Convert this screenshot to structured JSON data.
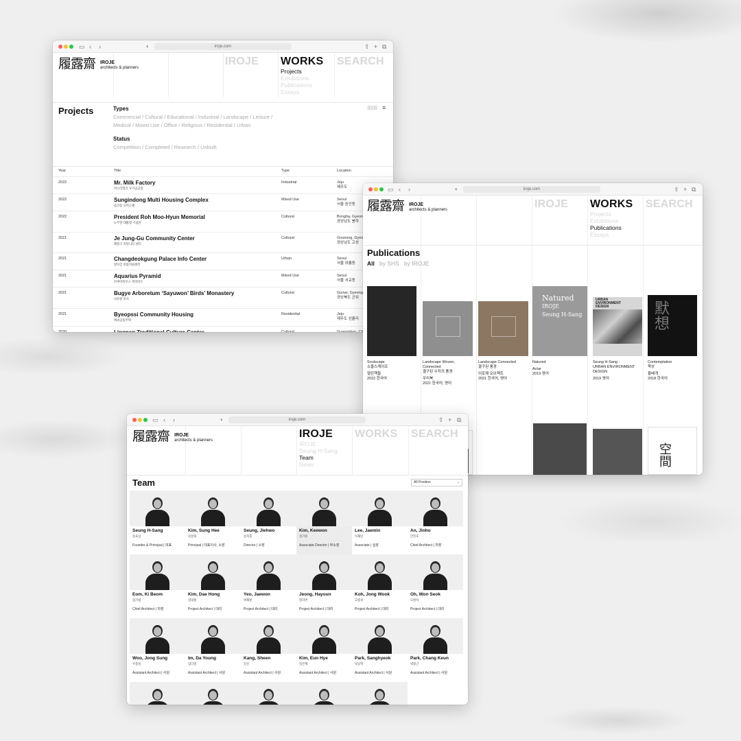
{
  "url": "iroje.com",
  "logo": {
    "hanja": "履露齋",
    "name": "IROJE",
    "tagline": "architects & planners"
  },
  "nav": {
    "iroje": "IROJE",
    "works": "WORKS",
    "search": "SEARCH"
  },
  "works_sub": [
    "Projects",
    "Exhibitions",
    "Publications",
    "Essays"
  ],
  "iroje_sub": [
    "IROJE",
    "Seung H-Sang",
    "Team",
    "News"
  ],
  "projects": {
    "title": "Projects",
    "types_label": "Types",
    "types_line1": "Commercial / Cultural / Educational / Industrial / Landscape / Leisure /",
    "types_line2": "Medical / Mixed Use / Office / Religious / Residential / Urban",
    "status_label": "Status",
    "status_line": "Competition / Completed / Research / Unbuilt",
    "headers": {
      "year": "Year",
      "title": "Title",
      "type": "Type",
      "location": "Location"
    },
    "rows": [
      {
        "year": "2022",
        "title": "Mr. Milk Factory",
        "ko": "미스터밀크 우기공공장",
        "type": "Industrial",
        "loc1": "Jeju",
        "loc2": "제주도"
      },
      {
        "year": "2022",
        "title": "Sungindong Multi Housing Complex",
        "ko": "숭인동 오피스텔",
        "type": "Mixed Use",
        "loc1": "Seoul",
        "loc2": "서울 숭인동"
      },
      {
        "year": "2022",
        "title": "President Roh Moo-Hyun Memorial",
        "ko": "노무현 대통령 기념관",
        "type": "Cultural",
        "loc1": "Bongha, Gyeongsangnam",
        "loc2": "경상남도 봉하"
      },
      {
        "year": "2021",
        "title": "Je Jung-Gu Community Center",
        "ko": "제정구 커뮤니티 센터",
        "type": "Cultural",
        "loc1": "Goseong, Gyeongsangnam",
        "loc2": "경상남도 고성"
      },
      {
        "year": "2021",
        "title": "Changdeokgung Palace Info Center",
        "ko": "창덕궁 관람지원센터",
        "type": "Urban",
        "loc1": "Seoul",
        "loc2": "서울 와룡동"
      },
      {
        "year": "2021",
        "title": "Aquarius Pyramid",
        "ko": "아쿠아리우스 피라미드",
        "type": "Mixed Use",
        "loc1": "Seoul",
        "loc2": "서울 서교동"
      },
      {
        "year": "2021",
        "title": "Bugye Arboretum ‘Sayuwon’ Birds’ Monastery",
        "ko": "사유원 조사",
        "type": "Cultural",
        "loc1": "Gunwi, Gyeong",
        "loc2": "경상북도 군위"
      },
      {
        "year": "2021",
        "title": "Byeopssi Community Housing",
        "ko": "벼씨공동주택",
        "type": "Residential",
        "loc1": "Jeju",
        "loc2": "제주도 선흘리"
      },
      {
        "year": "2020",
        "title": "Lingnan Traditional Culture Center",
        "ko": "",
        "type": "Cultural",
        "loc1": "Guangzhou, Chi",
        "loc2": ""
      }
    ]
  },
  "publications": {
    "title": "Publications",
    "filters": [
      "All",
      "by SHS",
      "by IROJE"
    ],
    "books": [
      {
        "t1": "Soulscape",
        "t2": "소울스케이프",
        "t3": "",
        "p1": "열린책들",
        "p2": "2022 한국어",
        "color": "#262626"
      },
      {
        "t1": "Landscape Woven,",
        "t2": "Connected",
        "t3": "결구된 수직의 풍경",
        "p1": "우리북",
        "p2": "2021 한국어, 영어",
        "color": "#8f8f8f"
      },
      {
        "t1": "Landscape Connected",
        "t2": "결구된 풍경",
        "t3": "",
        "p1": "이로제 오브젝트",
        "p2": "2021 한국어, 영어",
        "color": "#8c7762"
      },
      {
        "t1": "Natured",
        "t2": "",
        "t3": "",
        "p1": "Actar",
        "p2": "2019 영어",
        "color": "#9a9a9a",
        "cover": [
          "Natured",
          "IROJE",
          "Seung H-Sang"
        ]
      },
      {
        "t1": "Seung H-Sang :",
        "t2": "",
        "t3": "URBAN ENVIRONMENT DESIGN",
        "p1": "2019 영어",
        "p2": "",
        "color": "#d6d6d6",
        "cover": [
          "URBAN",
          "ENVIRONMENT",
          "DESIGN"
        ]
      },
      {
        "t1": "Contemplation",
        "t2": "묵상",
        "t3": "",
        "p1": "돌베개",
        "p2": "2018 한국어",
        "color": "#121212",
        "cover": [
          "默",
          "想"
        ]
      }
    ],
    "row2_cover_text": [
      "空",
      "間"
    ]
  },
  "team": {
    "title": "Team",
    "select": "All Position",
    "members": [
      {
        "name": "Seung H-Sang",
        "ko": "승효상",
        "role": "Founder & Principal | 대표"
      },
      {
        "name": "Kim, Sung Hee",
        "ko": "김성희",
        "role": "Principal | 대표이사, 소장"
      },
      {
        "name": "Seung, Jiehwo",
        "ko": "승지후",
        "role": "Director | 소장"
      },
      {
        "name": "Kim, Keewon",
        "ko": "김기원",
        "role": "Associate Director | 부소장"
      },
      {
        "name": "Lee, Jaemin",
        "ko": "이재민",
        "role": "Associate | 실장"
      },
      {
        "name": "An, Jinho",
        "ko": "안진호",
        "role": "Chief Architect | 차장"
      },
      {
        "name": "Eom, Ki Beom",
        "ko": "엄기범",
        "role": "Chief Architect | 차장"
      },
      {
        "name": "Kim, Dae Hong",
        "ko": "김대홍",
        "role": "Project Architect | 대리"
      },
      {
        "name": "Yeo, Jaewon",
        "ko": "여재원",
        "role": "Project Architect | 대리"
      },
      {
        "name": "Jeong, Hayoun",
        "ko": "정하연",
        "role": "Project Architect | 대리"
      },
      {
        "name": "Koh, Jong Wook",
        "ko": "고종욱",
        "role": "Project Architect | 대리"
      },
      {
        "name": "Oh, Won Seok",
        "ko": "오원석",
        "role": "Project Architect | 대리"
      },
      {
        "name": "Woo, Jong Sung",
        "ko": "우종성",
        "role": "Assistant Architect | 사원"
      },
      {
        "name": "Im, Da Young",
        "ko": "임다영",
        "role": "Assistant Architect | 사원"
      },
      {
        "name": "Kang, Sheen",
        "ko": "강신",
        "role": "Assistant Architect | 사원"
      },
      {
        "name": "Kim, Eun Hye",
        "ko": "김은혜",
        "role": "Assistant Architect | 사원"
      },
      {
        "name": "Park, Sanghyeok",
        "ko": "박상혁",
        "role": "Assistant Architect | 사원"
      },
      {
        "name": "Park, Chang Keun",
        "ko": "박창근",
        "role": "Assistant Architect | 사원"
      }
    ]
  }
}
